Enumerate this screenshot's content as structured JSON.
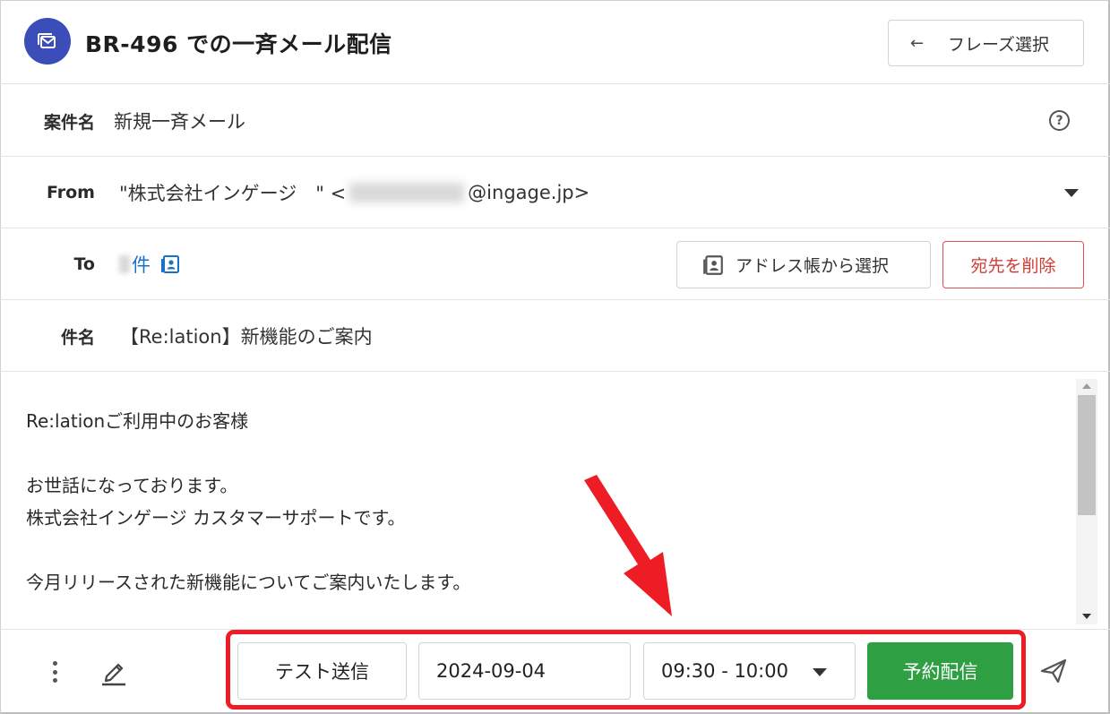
{
  "header": {
    "title": "BR-496 での一斉メール配信",
    "phrase_button": "フレーズ選択",
    "back_arrow": "←"
  },
  "fields": {
    "case_label": "案件名",
    "case_value": "新規一斉メール",
    "help_icon": "?",
    "from_label": "From",
    "from_value_prefix": "\"株式会社インゲージ　\" <",
    "from_value_suffix": "@ingage.jp>",
    "to_label": "To",
    "to_count_suffix": "件",
    "address_book_button": "アドレス帳から選択",
    "delete_recipients_button": "宛先を削除",
    "subject_label": "件名",
    "subject_value": "【Re:lation】新機能のご案内"
  },
  "body": {
    "text": "Re:lationご利用中のお客様\n\nお世話になっております。\n株式会社インゲージ カスタマーサポートです。\n\n今月リリースされた新機能についてご案内いたします。"
  },
  "footer": {
    "test_send_button": "テスト送信",
    "date_value": "2024-09-04",
    "time_value": "09:30 - 10:00",
    "schedule_button": "予約配信"
  },
  "colors": {
    "brand": "#3b4db8",
    "primary_green": "#2ea043",
    "danger_red": "#d23c35",
    "annotation_red": "#ee1c24",
    "link_blue": "#1a6fc9"
  },
  "icons": {
    "app": "mail-stack-icon",
    "help": "help-circle-icon",
    "address_book": "contact-book-icon",
    "more": "kebab-menu-icon",
    "edit": "pen-icon",
    "send": "paper-plane-icon"
  }
}
